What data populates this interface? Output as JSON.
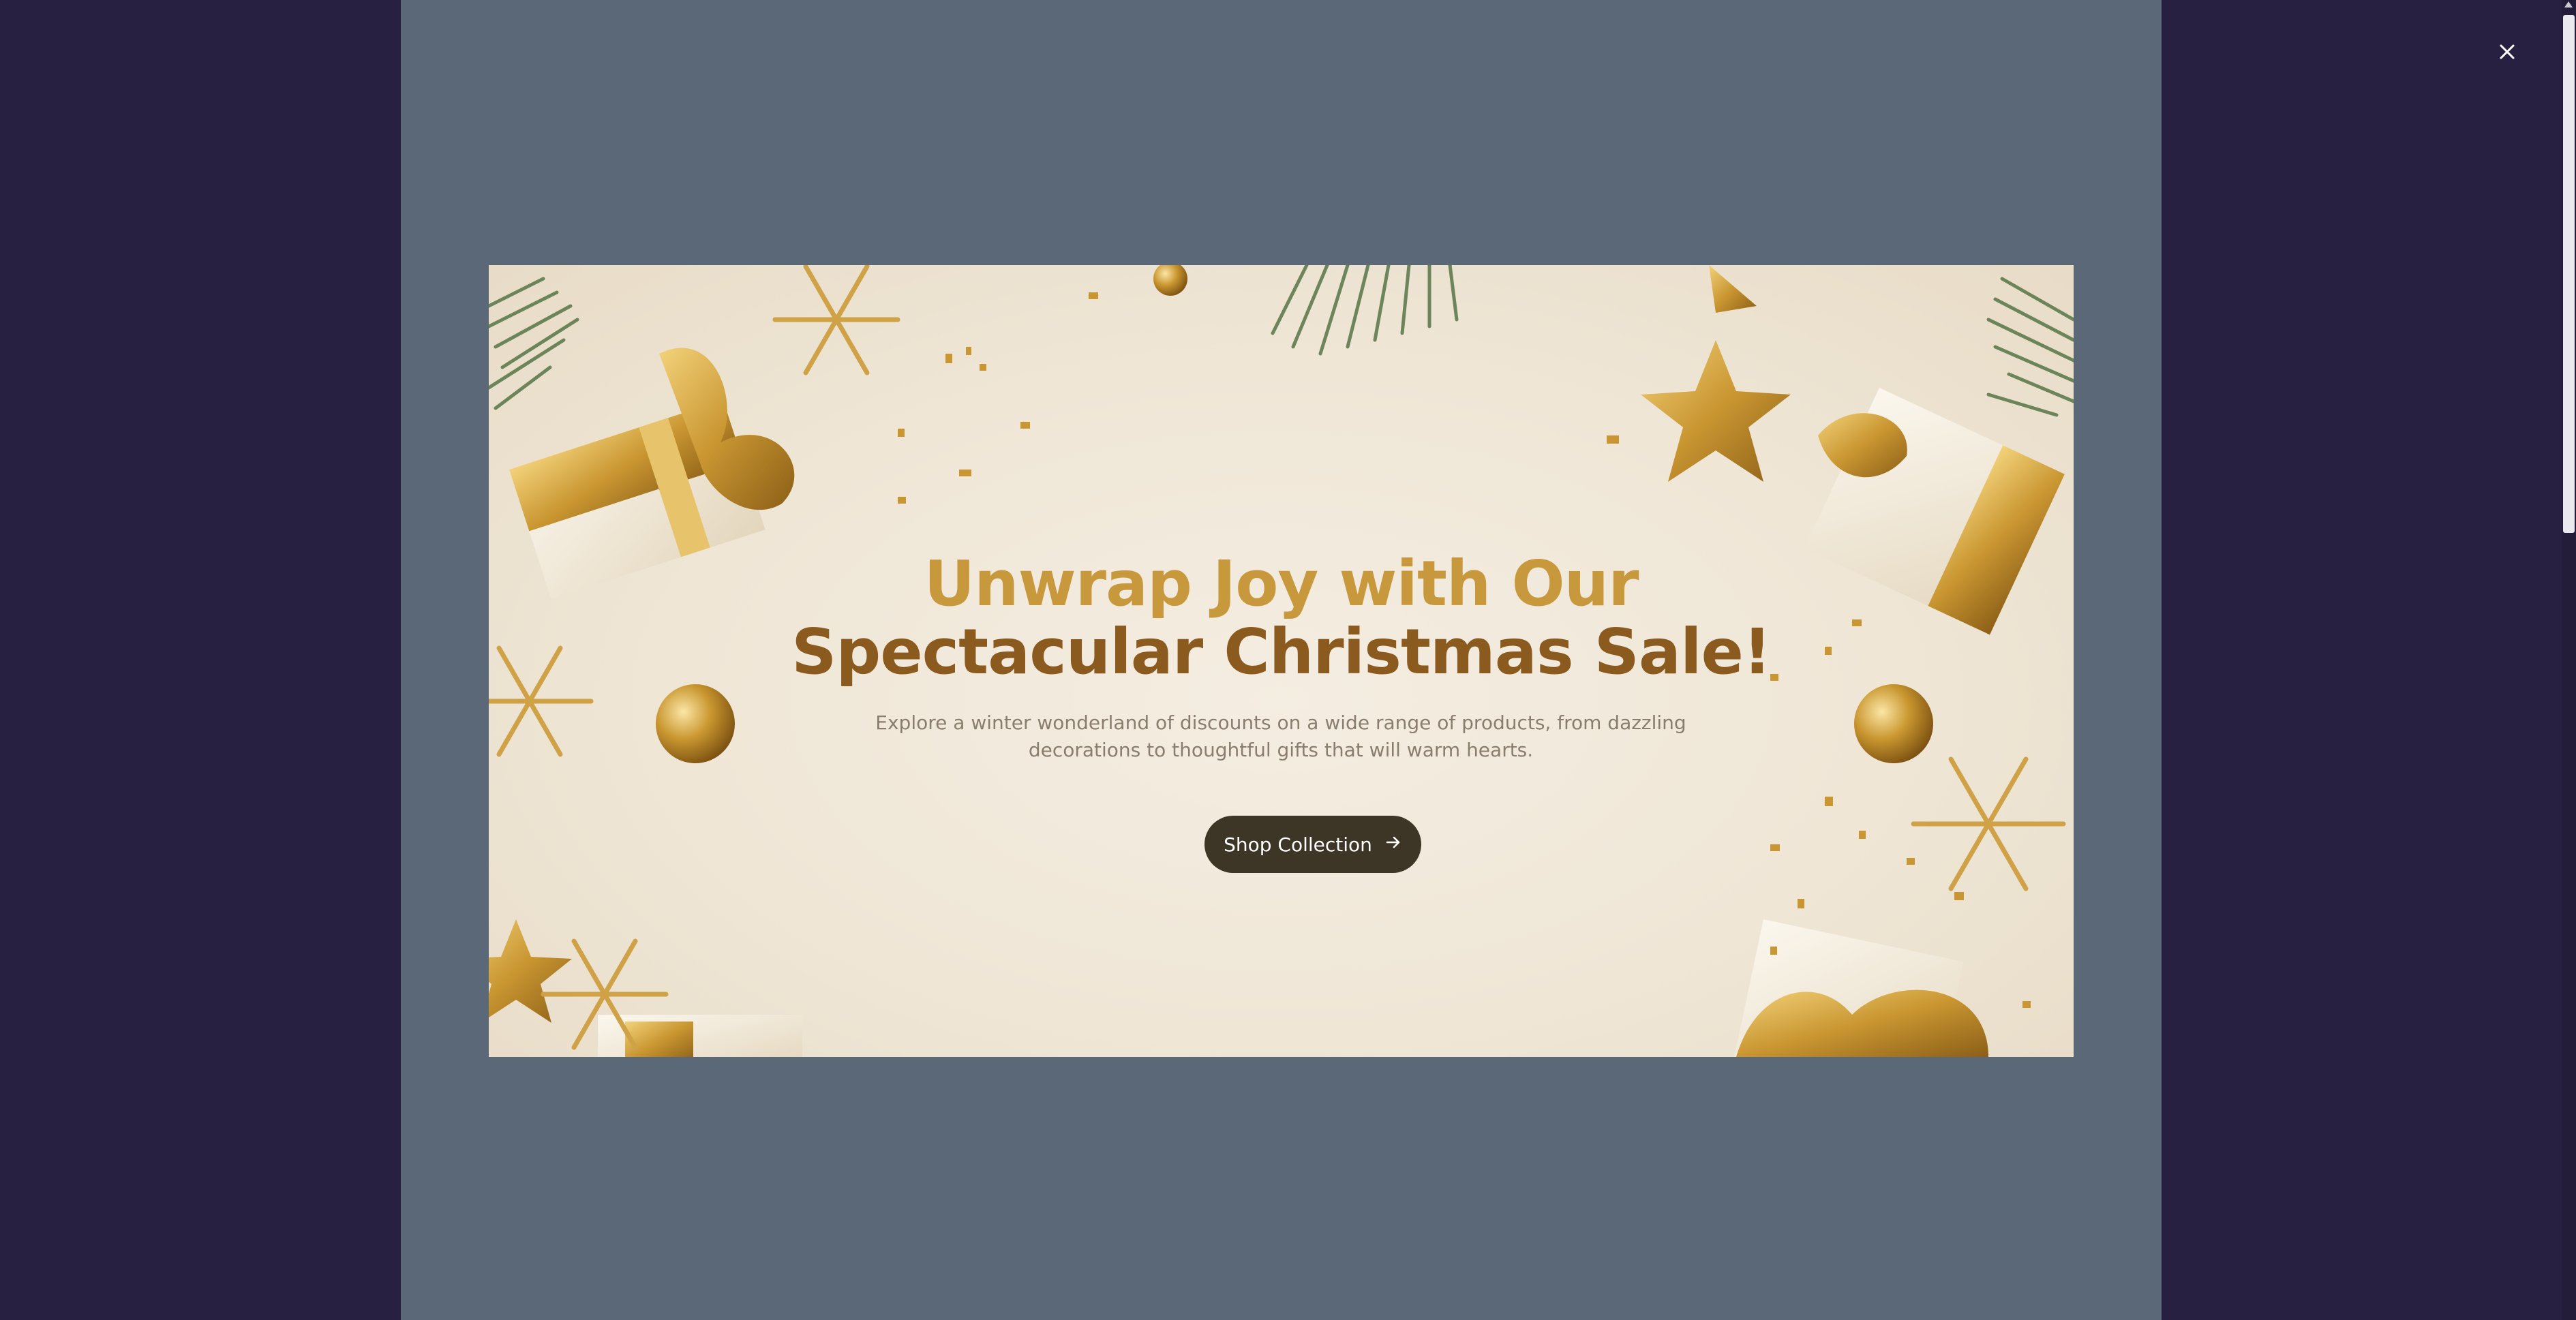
{
  "modal": {
    "close_icon": "close-icon",
    "close_label": "Close"
  },
  "banner": {
    "headline_line1": "Unwrap Joy with Our",
    "headline_line2": "Spectacular Christmas Sale!",
    "description": "Explore a winter wonderland of discounts on a wide range of products, from dazzling decorations to thoughtful gifts that will warm hearts.",
    "cta_label": "Shop Collection",
    "cta_icon": "arrow-right-icon"
  },
  "colors": {
    "backdrop": "#272040",
    "frame": "#5b6878",
    "headline_gold": "#c8983d",
    "headline_brown": "#8a5a1f",
    "button": "#3d3526"
  }
}
